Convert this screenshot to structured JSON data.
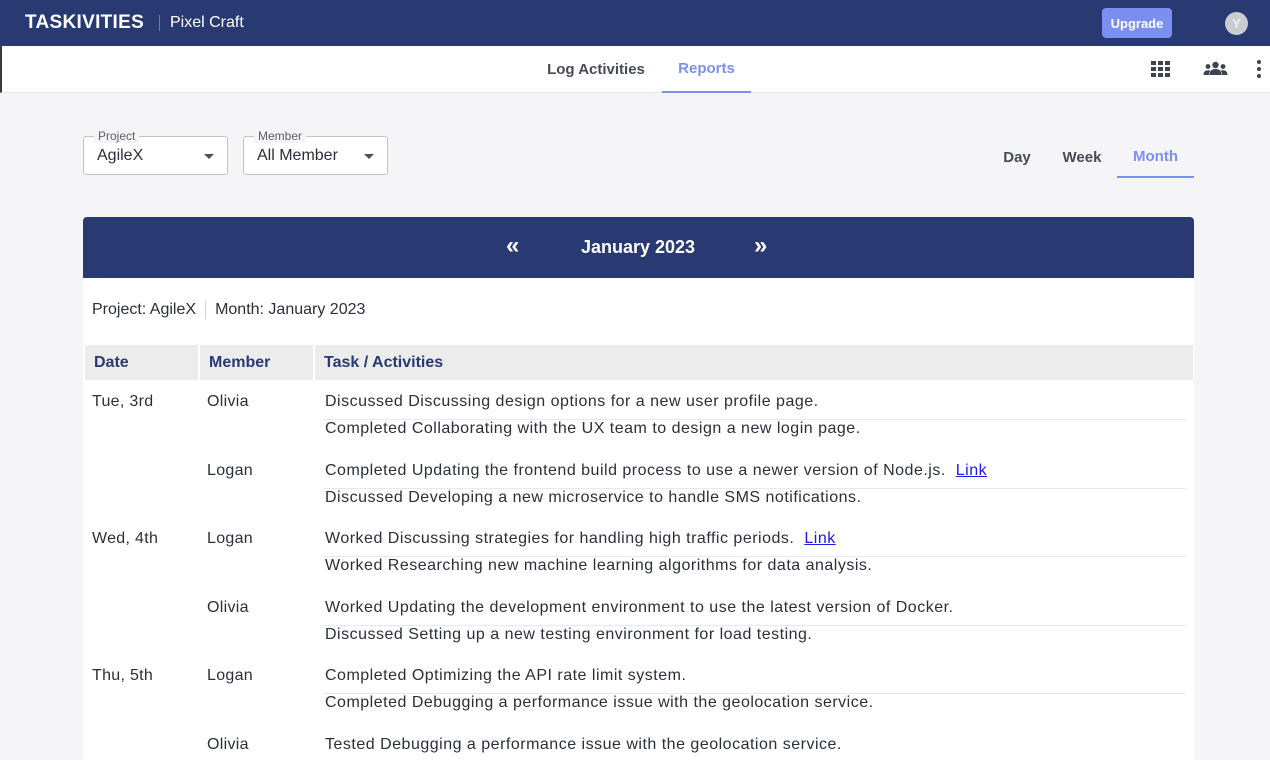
{
  "app": {
    "logo": "TASKIVITIES",
    "workspace": "Pixel Craft",
    "upgrade_label": "Upgrade",
    "avatar_initial": "Y"
  },
  "nav": {
    "tabs": [
      {
        "label": "Log Activities",
        "active": false
      },
      {
        "label": "Reports",
        "active": true
      }
    ],
    "icons": [
      "grid-icon",
      "people-icon",
      "kebab-menu-icon"
    ]
  },
  "filters": {
    "project": {
      "label": "Project",
      "value": "AgileX"
    },
    "member": {
      "label": "Member",
      "value": "All Member"
    }
  },
  "period_tabs": [
    {
      "label": "Day",
      "active": false
    },
    {
      "label": "Week",
      "active": false
    },
    {
      "label": "Month",
      "active": true
    }
  ],
  "report": {
    "prev_symbol": "«",
    "next_symbol": "»",
    "title": "January 2023",
    "summary_project": "Project: AgileX",
    "summary_month": "Month: January 2023",
    "columns": [
      "Date",
      "Member",
      "Task / Activities"
    ],
    "link_label": "Link",
    "rows": [
      {
        "date": "Tue, 3rd",
        "member": "Olivia",
        "activities": [
          {
            "text": "Discussed Discussing design options for a new user profile page.",
            "link": false
          },
          {
            "text": "Completed Collaborating with the UX team to design a new login page.",
            "link": false
          }
        ]
      },
      {
        "date": "",
        "member": "Logan",
        "activities": [
          {
            "text": "Completed Updating the frontend build process to use a newer version of Node.js.",
            "link": true
          },
          {
            "text": "Discussed Developing a new microservice to handle SMS notifications.",
            "link": false
          }
        ]
      },
      {
        "date": "Wed, 4th",
        "member": "Logan",
        "activities": [
          {
            "text": "Worked Discussing strategies for handling high traffic periods.",
            "link": true
          },
          {
            "text": "Worked Researching new machine learning algorithms for data analysis.",
            "link": false
          }
        ]
      },
      {
        "date": "",
        "member": "Olivia",
        "activities": [
          {
            "text": "Worked Updating the development environment to use the latest version of Docker.",
            "link": false
          },
          {
            "text": "Discussed Setting up a new testing environment for load testing.",
            "link": false
          }
        ]
      },
      {
        "date": "Thu, 5th",
        "member": "Logan",
        "activities": [
          {
            "text": "Completed Optimizing the API rate limit system.",
            "link": false
          },
          {
            "text": "Completed Debugging a performance issue with the geolocation service.",
            "link": false
          }
        ]
      },
      {
        "date": "",
        "member": "Olivia",
        "activities": [
          {
            "text": "Tested Debugging a performance issue with the geolocation service.",
            "link": false
          },
          {
            "text": "",
            "link": false
          }
        ]
      }
    ]
  },
  "colors": {
    "navy": "#293a73",
    "accent": "#7b8ff0",
    "link": "#1a1ae6"
  }
}
